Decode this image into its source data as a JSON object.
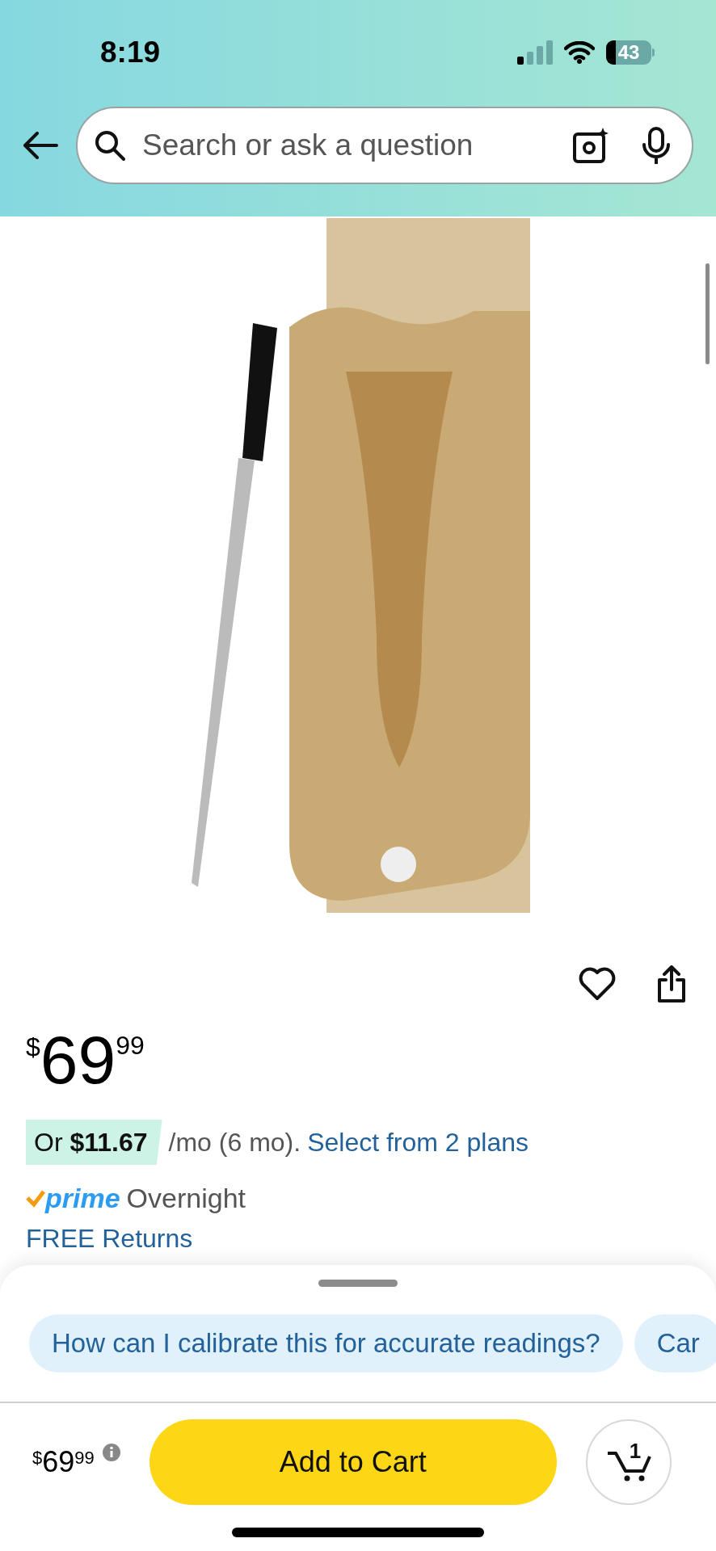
{
  "status_bar": {
    "time": "8:19",
    "battery": "43"
  },
  "search": {
    "placeholder": "Search or ask a question"
  },
  "price": {
    "symbol": "$",
    "whole": "69",
    "fraction": "99"
  },
  "installment": {
    "offer": "Or **$11.67**",
    "terms": "/mo (6 mo).",
    "link": "Select from 2 plans"
  },
  "delivery": {
    "badge": "prime",
    "speed": "Overnight",
    "returns": "FREE Returns"
  },
  "suggestions": [
    "How can I calibrate this for accurate readings?",
    "Car"
  ],
  "buy_bar": {
    "price": {
      "symbol": "$",
      "whole": "69",
      "fraction": "99"
    },
    "button": "Add to Cart",
    "cart_count": "1"
  }
}
